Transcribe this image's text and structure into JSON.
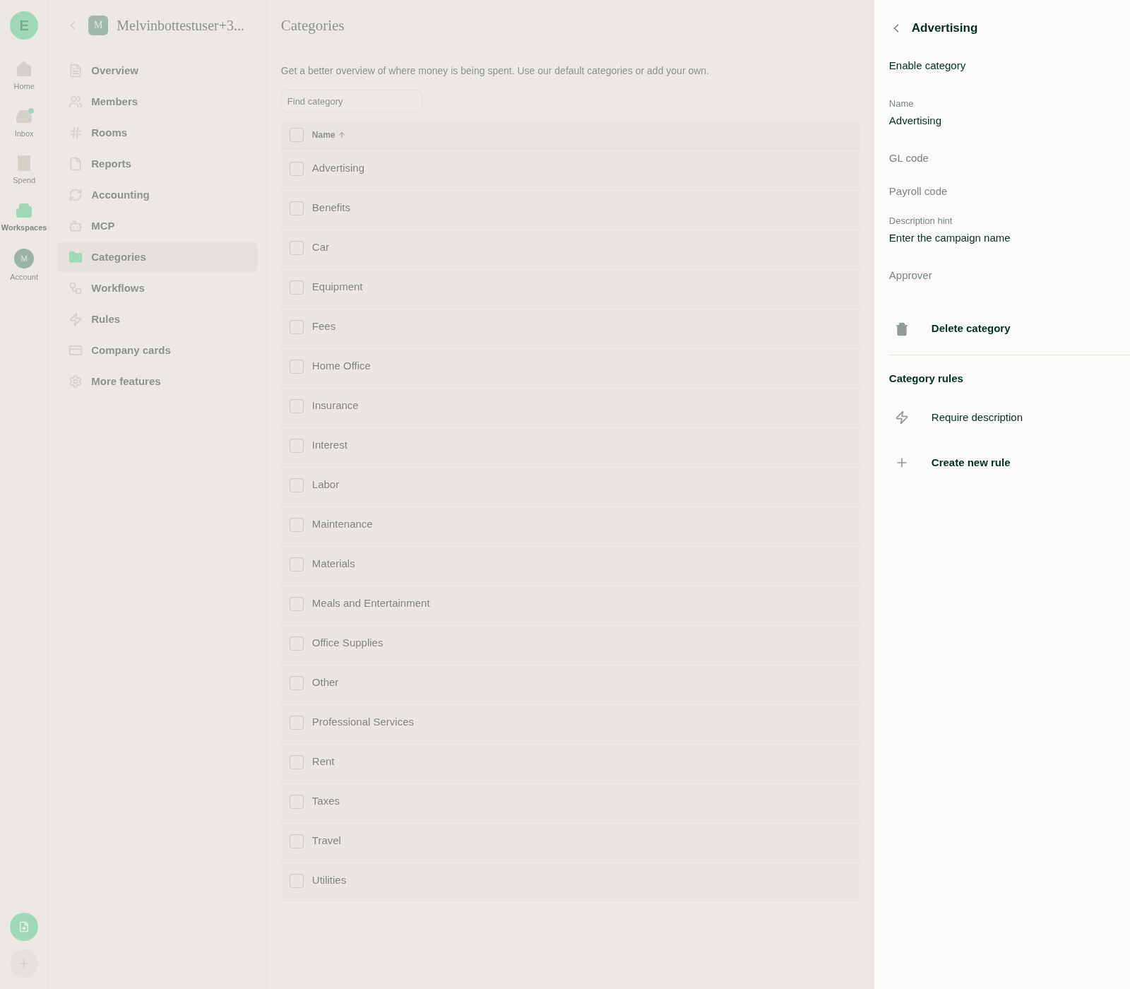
{
  "rail": {
    "logo": "E",
    "items": [
      {
        "label": "Home",
        "selected": false,
        "badge": false
      },
      {
        "label": "Inbox",
        "selected": false,
        "badge": true
      },
      {
        "label": "Spend",
        "selected": false,
        "badge": false
      },
      {
        "label": "Workspaces",
        "selected": true,
        "badge": false
      },
      {
        "label": "Account",
        "selected": false,
        "badge": false,
        "avatar": "M"
      }
    ]
  },
  "sidebar": {
    "avatar": "M",
    "title": "Melvinbottestuser+3...",
    "items": [
      {
        "label": "Overview",
        "selected": false
      },
      {
        "label": "Members",
        "selected": false
      },
      {
        "label": "Rooms",
        "selected": false
      },
      {
        "label": "Reports",
        "selected": false
      },
      {
        "label": "Accounting",
        "selected": false
      },
      {
        "label": "MCP",
        "selected": false
      },
      {
        "label": "Categories",
        "selected": true
      },
      {
        "label": "Workflows",
        "selected": false
      },
      {
        "label": "Rules",
        "selected": false
      },
      {
        "label": "Company cards",
        "selected": false
      },
      {
        "label": "More features",
        "selected": false
      }
    ]
  },
  "main": {
    "title": "Categories",
    "description": "Get a better overview of where money is being spent. Use our default categories or add your own.",
    "search": {
      "placeholder": "Find category"
    },
    "table": {
      "all_checked": false,
      "columns": [
        {
          "label": "Name",
          "sorted": true
        }
      ],
      "rows": [
        {
          "name": "Advertising",
          "checked": false
        },
        {
          "name": "Benefits",
          "checked": false
        },
        {
          "name": "Car",
          "checked": false
        },
        {
          "name": "Equipment",
          "checked": false
        },
        {
          "name": "Fees",
          "checked": false
        },
        {
          "name": "Home Office",
          "checked": false
        },
        {
          "name": "Insurance",
          "checked": false
        },
        {
          "name": "Interest",
          "checked": false
        },
        {
          "name": "Labor",
          "checked": false
        },
        {
          "name": "Maintenance",
          "checked": false
        },
        {
          "name": "Materials",
          "checked": false
        },
        {
          "name": "Meals and Entertainment",
          "checked": false
        },
        {
          "name": "Office Supplies",
          "checked": false
        },
        {
          "name": "Other",
          "checked": false
        },
        {
          "name": "Professional Services",
          "checked": false
        },
        {
          "name": "Rent",
          "checked": false
        },
        {
          "name": "Taxes",
          "checked": false
        },
        {
          "name": "Travel",
          "checked": false
        },
        {
          "name": "Utilities",
          "checked": false
        }
      ]
    }
  },
  "panel": {
    "title": "Advertising",
    "enable_label": "Enable category",
    "fields": [
      {
        "label": "Name",
        "value": "Advertising"
      },
      {
        "label": "GL code"
      },
      {
        "label": "Payroll code"
      },
      {
        "label": "Description hint",
        "value": "Enter the campaign name"
      },
      {
        "label": "Approver"
      }
    ],
    "delete_label": "Delete category",
    "rules_title": "Category rules",
    "rules": [
      {
        "kind": "rule",
        "label": "Require description"
      },
      {
        "kind": "create",
        "label": "Create new rule"
      }
    ]
  }
}
